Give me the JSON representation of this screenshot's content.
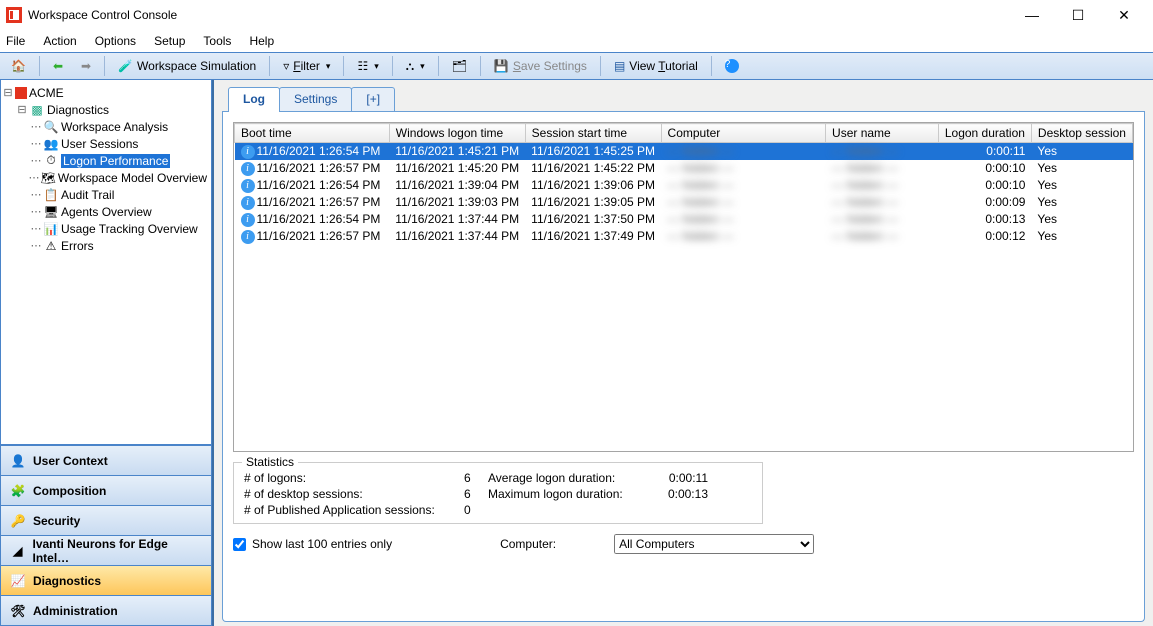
{
  "window": {
    "title": "Workspace Control Console"
  },
  "menu": [
    "File",
    "Action",
    "Options",
    "Setup",
    "Tools",
    "Help"
  ],
  "toolbar": {
    "simulation": "Workspace Simulation",
    "filter": "Filter",
    "save": "Save Settings",
    "tutorial": "View Tutorial"
  },
  "tree": {
    "root": "ACME",
    "group": "Diagnostics",
    "items": [
      "Workspace Analysis",
      "User Sessions",
      "Logon Performance",
      "Workspace Model Overview",
      "Audit Trail",
      "Agents Overview",
      "Usage Tracking Overview",
      "Errors"
    ],
    "selectedIndex": 2
  },
  "nav": [
    "User Context",
    "Composition",
    "Security",
    "Ivanti Neurons for Edge Intel…",
    "Diagnostics",
    "Administration"
  ],
  "nav_activeIndex": 4,
  "tabs": {
    "items": [
      "Log",
      "Settings",
      "[+]"
    ],
    "activeIndex": 0
  },
  "grid": {
    "headers": [
      "Boot time",
      "Windows logon time",
      "Session start time",
      "Computer",
      "User name",
      "Logon duration",
      "Desktop session"
    ],
    "rows": [
      {
        "boot": "11/16/2021 1:26:54 PM",
        "wlogon": "11/16/2021 1:45:21 PM",
        "sstart": "11/16/2021 1:45:25 PM",
        "comp": "— hidden —",
        "user": "— hidden —",
        "dur": "0:00:11",
        "desk": "Yes",
        "sel": true
      },
      {
        "boot": "11/16/2021 1:26:57 PM",
        "wlogon": "11/16/2021 1:45:20 PM",
        "sstart": "11/16/2021 1:45:22 PM",
        "comp": "— hidden —",
        "user": "— hidden —",
        "dur": "0:00:10",
        "desk": "Yes"
      },
      {
        "boot": "11/16/2021 1:26:54 PM",
        "wlogon": "11/16/2021 1:39:04 PM",
        "sstart": "11/16/2021 1:39:06 PM",
        "comp": "— hidden —",
        "user": "— hidden —",
        "dur": "0:00:10",
        "desk": "Yes"
      },
      {
        "boot": "11/16/2021 1:26:57 PM",
        "wlogon": "11/16/2021 1:39:03 PM",
        "sstart": "11/16/2021 1:39:05 PM",
        "comp": "— hidden —",
        "user": "— hidden —",
        "dur": "0:00:09",
        "desk": "Yes"
      },
      {
        "boot": "11/16/2021 1:26:54 PM",
        "wlogon": "11/16/2021 1:37:44 PM",
        "sstart": "11/16/2021 1:37:50 PM",
        "comp": "— hidden —",
        "user": "— hidden —",
        "dur": "0:00:13",
        "desk": "Yes"
      },
      {
        "boot": "11/16/2021 1:26:57 PM",
        "wlogon": "11/16/2021 1:37:44 PM",
        "sstart": "11/16/2021 1:37:49 PM",
        "comp": "— hidden —",
        "user": "— hidden —",
        "dur": "0:00:12",
        "desk": "Yes"
      }
    ]
  },
  "stats": {
    "legend": "Statistics",
    "logons_label": "# of logons:",
    "logons": "6",
    "desktop_label": "# of desktop sessions:",
    "desktop": "6",
    "pub_label": "# of Published Application sessions:",
    "pub": "0",
    "avg_label": "Average logon duration:",
    "avg": "0:00:11",
    "max_label": "Maximum logon duration:",
    "max": "0:00:13"
  },
  "footer": {
    "show100": "Show last 100 entries only",
    "computer_label": "Computer:",
    "computer_value": "All Computers"
  }
}
